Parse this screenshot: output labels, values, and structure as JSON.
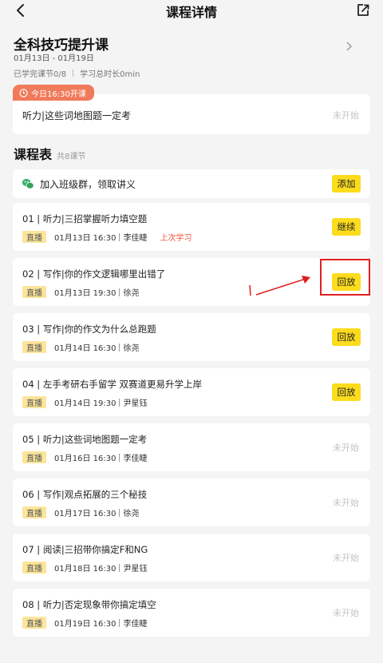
{
  "nav": {
    "title": "课程详情",
    "back_icon": "chevron-left-icon",
    "share_icon": "share-icon"
  },
  "course": {
    "title": "全科技巧提升课",
    "dates": "01月13日 - 01月19日",
    "completed": "已学完课节0/8",
    "duration": "学习总时长0min"
  },
  "live_today": {
    "tag": "今日16:30开课",
    "title": "听力|这些词地图题一定考",
    "status": "未开始"
  },
  "schedule": {
    "title": "课程表",
    "count": "共8课节"
  },
  "group": {
    "text": "加入班级群，领取讲义",
    "button": "添加"
  },
  "lessons": [
    {
      "title": "01 | 听力|三招掌握听力填空题",
      "badge": "直播",
      "time": "01月13日 16:30",
      "teacher": "李佳睫",
      "note": "上次学习",
      "action": "继续",
      "action_type": "button"
    },
    {
      "title": "02 | 写作|你的作文逻辑哪里出错了",
      "badge": "直播",
      "time": "01月13日 19:30",
      "teacher": "徐尧",
      "note": "",
      "action": "回放",
      "action_type": "button"
    },
    {
      "title": "03 | 写作|你的作文为什么总跑题",
      "badge": "直播",
      "time": "01月14日 16:30",
      "teacher": "徐尧",
      "note": "",
      "action": "回放",
      "action_type": "button"
    },
    {
      "title": "04 | 左手考研右手留学 双赛道更易升学上岸",
      "badge": "直播",
      "time": "01月14日 19:30",
      "teacher": "尹星钰",
      "note": "",
      "action": "回放",
      "action_type": "button"
    },
    {
      "title": "05 | 听力|这些词地图题一定考",
      "badge": "直播",
      "time": "01月16日 16:30",
      "teacher": "李佳睫",
      "note": "",
      "action": "未开始",
      "action_type": "status"
    },
    {
      "title": "06 | 写作|观点拓展的三个秘技",
      "badge": "直播",
      "time": "01月17日 16:30",
      "teacher": "徐尧",
      "note": "",
      "action": "未开始",
      "action_type": "status"
    },
    {
      "title": "07 | 阅读|三招带你搞定F和NG",
      "badge": "直播",
      "time": "01月18日 16:30",
      "teacher": "尹星钰",
      "note": "",
      "action": "未开始",
      "action_type": "status"
    },
    {
      "title": "08 | 听力|否定现象带你搞定填空",
      "badge": "直播",
      "time": "01月19日 16:30",
      "teacher": "李佳睫",
      "note": "",
      "action": "未开始",
      "action_type": "status"
    }
  ],
  "colors": {
    "accent_yellow": "#fcdc1d",
    "badge_yellow": "#fbe59a",
    "tag_orange": "#f07a5a",
    "last_learn_red": "#f0573c",
    "annotation_red": "#e02020"
  }
}
